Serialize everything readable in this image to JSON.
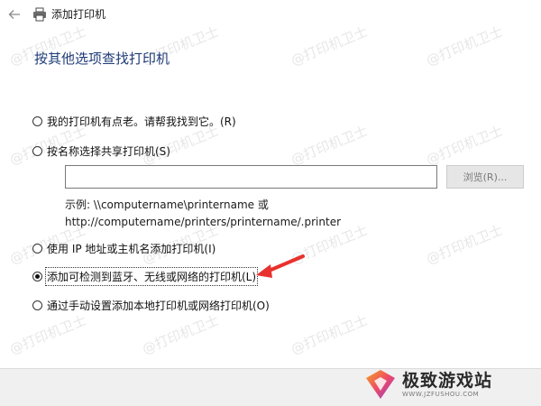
{
  "window": {
    "title": "添加打印机",
    "back_icon": "back-arrow-icon",
    "title_icon": "printer-icon"
  },
  "heading": "按其他选项查找打印机",
  "options": [
    {
      "label": "我的打印机有点老。请帮我找到它。(R)",
      "checked": false
    },
    {
      "label": "按名称选择共享打印机(S)",
      "checked": false
    },
    {
      "label": "使用 IP 地址或主机名添加打印机(I)",
      "checked": false
    },
    {
      "label": "添加可检测到蓝牙、无线或网络的打印机(L)",
      "checked": true
    },
    {
      "label": "通过手动设置添加本地打印机或网络打印机(O)",
      "checked": false
    }
  ],
  "share_input": {
    "value": "",
    "placeholder": ""
  },
  "browse_button": "浏览(R)...",
  "example": {
    "line1": "示例: \\\\computername\\printername 或",
    "line2": "http://computername/printers/printername/.printer"
  },
  "watermark": "@打印机卫士",
  "logo": {
    "main": "极致游戏站",
    "sub": "WWW.JZFUSHOU.COM"
  },
  "colors": {
    "heading": "#1f3b77",
    "annotation_arrow": "#e8322d",
    "footer_bg": "#f0f0f0"
  }
}
